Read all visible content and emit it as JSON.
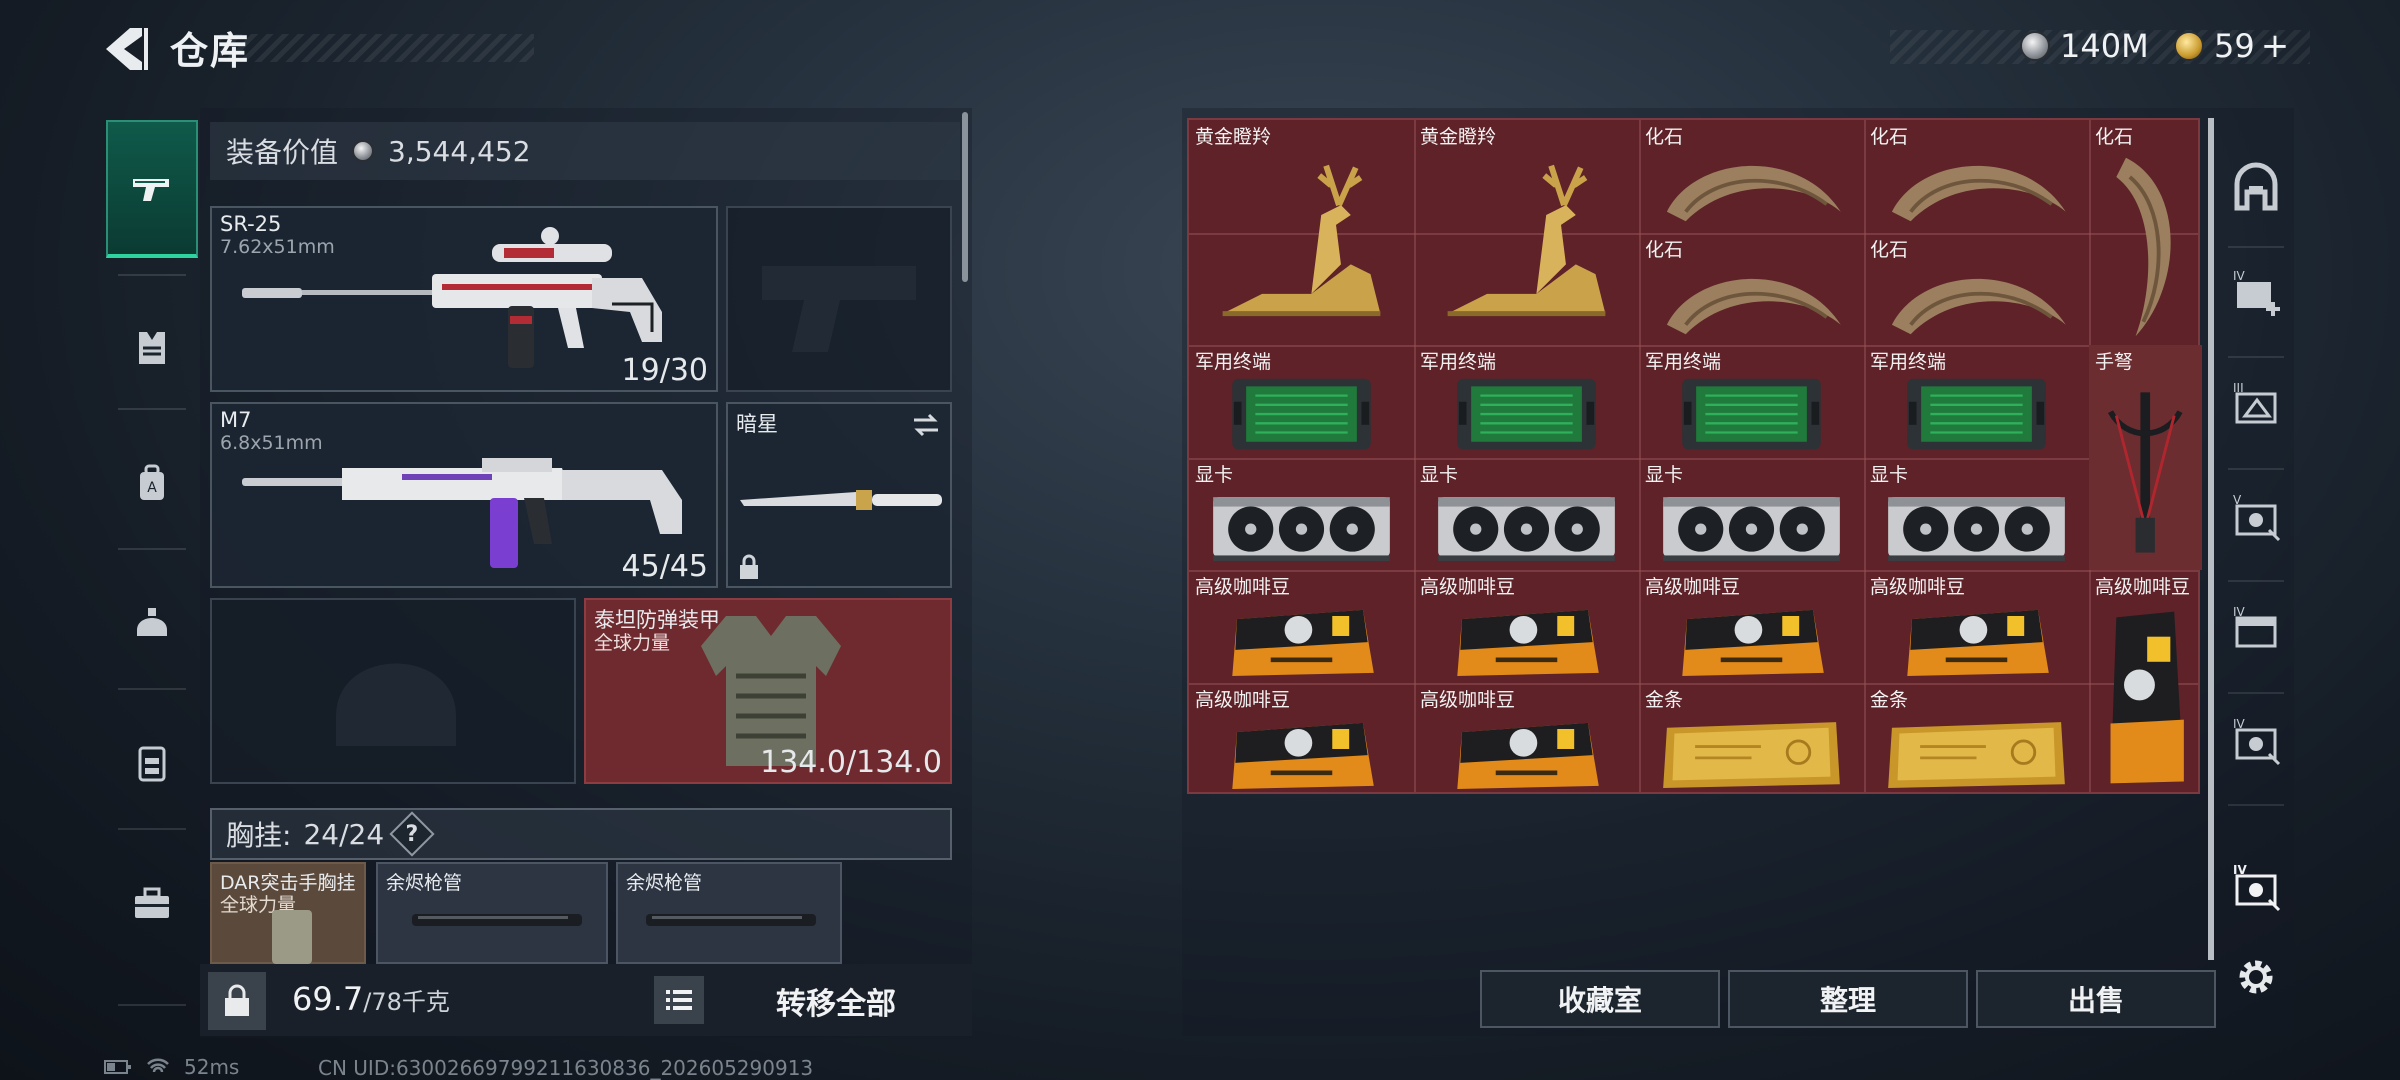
{
  "header": {
    "title": "仓库",
    "currency_silver": "140M",
    "currency_gold": "59",
    "currency_gold_plus": "+"
  },
  "left_rail": {
    "items": [
      "pistol-icon",
      "armor-icon",
      "backpack-icon",
      "helmet-icon",
      "rig-icon",
      "toolbox-icon"
    ],
    "active": "pistol-icon"
  },
  "equipment": {
    "value_label": "装备价值",
    "value": "3,544,452",
    "primary": {
      "name": "SR-25",
      "caliber": "7.62x51mm",
      "ammo": "19/30"
    },
    "secondary": {
      "name": "M7",
      "caliber": "6.8x51mm",
      "ammo": "45/45"
    },
    "melee": {
      "name": "暗星"
    },
    "armor": {
      "name": "泰坦防弹装甲",
      "sub": "全球力量",
      "durability": "134.0/134.0"
    },
    "chest_label": "胸挂:",
    "chest_value": "24/24",
    "chest_help": "?",
    "rig_items": [
      {
        "name": "DAR突击手胸挂",
        "sub": "全球力量"
      },
      {
        "name": "余烬枪管"
      },
      {
        "name": "余烬枪管"
      }
    ],
    "weight": "69.7",
    "weight_max": "/78千克",
    "transfer_all": "转移全部"
  },
  "stash": {
    "items": [
      {
        "label": "黄金瞪羚",
        "art": "gazelle"
      },
      {
        "label": "黄金瞪羚",
        "art": "gazelle"
      },
      {
        "label": "化石",
        "art": "claw"
      },
      {
        "label": "化石",
        "art": "claw"
      },
      {
        "label": "化石",
        "art": "claw-tall"
      },
      {
        "label": "化石",
        "art": "claw"
      },
      {
        "label": "化石",
        "art": "claw"
      },
      {
        "label": "军用终端",
        "art": "terminal"
      },
      {
        "label": "军用终端",
        "art": "terminal"
      },
      {
        "label": "军用终端",
        "art": "terminal"
      },
      {
        "label": "军用终端",
        "art": "terminal"
      },
      {
        "label": "手弩",
        "art": "crossbow"
      },
      {
        "label": "显卡",
        "art": "gpu"
      },
      {
        "label": "显卡",
        "art": "gpu"
      },
      {
        "label": "显卡",
        "art": "gpu"
      },
      {
        "label": "显卡",
        "art": "gpu"
      },
      {
        "label": "高级咖啡豆",
        "art": "coffee"
      },
      {
        "label": "高级咖啡豆",
        "art": "coffee"
      },
      {
        "label": "高级咖啡豆",
        "art": "coffee"
      },
      {
        "label": "高级咖啡豆",
        "art": "coffee"
      },
      {
        "label": "高级咖啡豆",
        "art": "coffee-tall"
      },
      {
        "label": "高级咖啡豆",
        "art": "coffee"
      },
      {
        "label": "高级咖啡豆",
        "art": "coffee"
      },
      {
        "label": "金条",
        "art": "goldbar"
      },
      {
        "label": "金条",
        "art": "goldbar"
      }
    ],
    "buttons": {
      "collection": "收藏室",
      "organize": "整理",
      "sell": "出售"
    }
  },
  "right_rail": {
    "items": [
      "safehouse-icon",
      "case-iv-add-icon",
      "case-iii-icon",
      "case-v-icon",
      "case-iv-icon",
      "case-iv-b-icon",
      "case-iv-c-icon",
      "settings-icon"
    ],
    "labels": [
      "",
      "IV",
      "III",
      "V",
      "IV",
      "IV",
      "IV",
      ""
    ]
  },
  "status": {
    "ping": "52ms",
    "uid": "CN UID:63002669799211630836_202605290913"
  }
}
